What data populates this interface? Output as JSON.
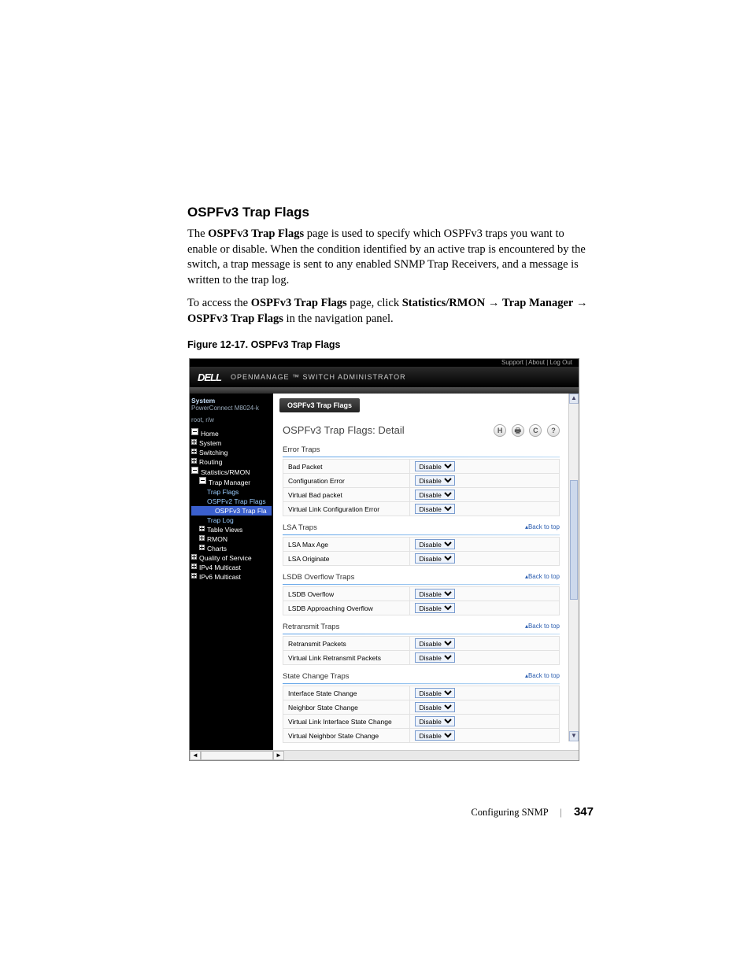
{
  "doc": {
    "section_title": "OSPFv3 Trap Flags",
    "para1_a": "The ",
    "para1_b": "OSPFv3 Trap Flags",
    "para1_c": " page is used to specify which OSPFv3 traps you want to enable or disable. When the condition identified by an active trap is encountered by the switch, a trap message is sent to any enabled SNMP Trap Receivers, and a message is written to the trap log.",
    "para2_a": "To access the ",
    "para2_b": "OSPFv3 Trap Flags",
    "para2_c": " page, click ",
    "para2_d": "Statistics/RMON",
    "para2_e": " → ",
    "para2_f": "Trap Manager",
    "para2_g": " → ",
    "para2_h": "OSPFv3 Trap Flags",
    "para2_i": " in the navigation panel.",
    "figure_caption": "Figure 12-17.    OSPFv3 Trap Flags",
    "footer_section": "Configuring SNMP",
    "footer_page": "347"
  },
  "shot": {
    "top_links": "Support  |  About  |  Log Out",
    "brand": "DELL",
    "brand_sub": "OPENMANAGE ™  SWITCH  ADMINISTRATOR",
    "nav": {
      "system": "System",
      "device": "PowerConnect M8024-k",
      "user": "root, r/w",
      "items": [
        {
          "cls": "col i1",
          "label": "Home"
        },
        {
          "cls": "exp i1",
          "label": "System"
        },
        {
          "cls": "exp i1",
          "label": "Switching"
        },
        {
          "cls": "exp i1",
          "label": "Routing"
        },
        {
          "cls": "col i1",
          "label": "Statistics/RMON"
        },
        {
          "cls": "col i2",
          "label": "Trap Manager"
        },
        {
          "cls": "i3",
          "label": "Trap Flags"
        },
        {
          "cls": "i3",
          "label": "OSPFv2 Trap Flags"
        },
        {
          "cls": "i4 sel",
          "label": "OSPFv3 Trap Fla"
        },
        {
          "cls": "i3",
          "label": "Trap Log"
        },
        {
          "cls": "exp i2",
          "label": "Table Views"
        },
        {
          "cls": "exp i2",
          "label": "RMON"
        },
        {
          "cls": "exp i2",
          "label": "Charts"
        },
        {
          "cls": "exp i1",
          "label": "Quality of Service"
        },
        {
          "cls": "exp i1",
          "label": "IPv4 Multicast"
        },
        {
          "cls": "exp i1",
          "label": "IPv6 Multicast"
        }
      ]
    },
    "tab": "OSPFv3 Trap Flags",
    "detail_title": "OSPFv3 Trap Flags: Detail",
    "icons": {
      "a": "H",
      "b": "🖶",
      "c": "C",
      "d": "?"
    },
    "back_to_top": "Back to top",
    "disable": "Disable",
    "groups": [
      {
        "title": "Error Traps",
        "show_btt": false,
        "rows": [
          "Bad Packet",
          "Configuration Error",
          "Virtual Bad packet",
          "Virtual Link Configuration Error"
        ]
      },
      {
        "title": "LSA Traps",
        "show_btt": true,
        "rows": [
          "LSA Max Age",
          "LSA Originate"
        ]
      },
      {
        "title": "LSDB Overflow Traps",
        "show_btt": true,
        "rows": [
          "LSDB Overflow",
          "LSDB Approaching Overflow"
        ]
      },
      {
        "title": "Retransmit Traps",
        "show_btt": true,
        "rows": [
          "Retransmit Packets",
          "Virtual Link Retransmit Packets"
        ]
      },
      {
        "title": "State Change Traps",
        "show_btt": true,
        "rows": [
          "Interface State Change",
          "Neighbor State Change",
          "Virtual Link Interface State Change",
          "Virtual Neighbor State Change"
        ]
      }
    ],
    "trailing_btt": true
  }
}
